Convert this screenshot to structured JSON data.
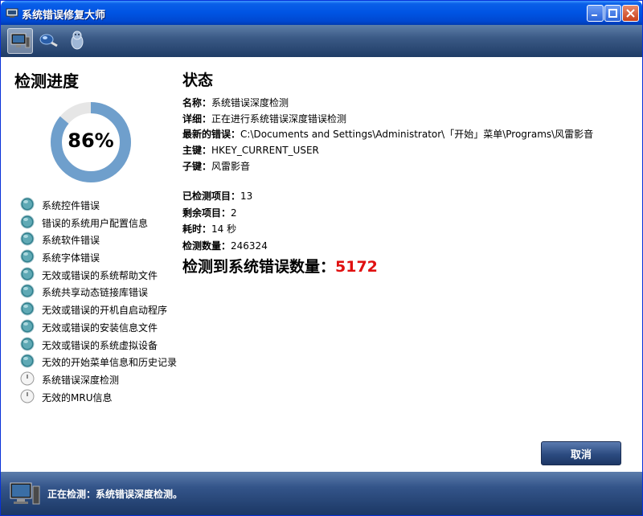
{
  "window": {
    "title": "系统错误修复大师"
  },
  "toolbar": {
    "icons": [
      "computer-icon",
      "search-icon",
      "tux-icon"
    ]
  },
  "progress": {
    "heading": "检测进度",
    "percent_text": "86%",
    "percent": 86
  },
  "checklist": [
    {
      "label": "系统控件错误",
      "state": "done"
    },
    {
      "label": "错误的系统用户配置信息",
      "state": "done"
    },
    {
      "label": "系统软件错误",
      "state": "done"
    },
    {
      "label": "系统字体错误",
      "state": "done"
    },
    {
      "label": "无效或错误的系统帮助文件",
      "state": "done"
    },
    {
      "label": "系统共享动态链接库错误",
      "state": "done"
    },
    {
      "label": "无效或错误的开机自启动程序",
      "state": "done"
    },
    {
      "label": "无效或错误的安装信息文件",
      "state": "done"
    },
    {
      "label": "无效或错误的系统虚拟设备",
      "state": "done"
    },
    {
      "label": "无效的开始菜单信息和历史记录(",
      "state": "done"
    },
    {
      "label": "系统错误深度检测",
      "state": "pending"
    },
    {
      "label": "无效的MRU信息",
      "state": "pending"
    }
  ],
  "status": {
    "heading": "状态",
    "name_label": "名称：",
    "name_value": "系统错误深度检测",
    "detail_label": "详细：",
    "detail_value": "正在进行系统错误深度错误检测",
    "latest_label": "最新的错误：",
    "latest_value": "C:\\Documents and Settings\\Administrator\\「开始」菜单\\Programs\\风雷影音",
    "key_label": "主键：",
    "key_value": "HKEY_CURRENT_USER",
    "subkey_label": "子键：",
    "subkey_value": "风雷影音",
    "checked_label": "已检测项目：",
    "checked_value": "13",
    "remaining_label": "剩余项目：",
    "remaining_value": "2",
    "elapsed_label": "耗时：",
    "elapsed_value": "14 秒",
    "count_label": "检测数量：",
    "count_value": "246324",
    "errors_label": "检测到系统错误数量：",
    "errors_value": "5172"
  },
  "buttons": {
    "cancel": "取消"
  },
  "statusbar": {
    "text": "正在检测：系统错误深度检测。"
  },
  "colors": {
    "accent_red": "#e01010",
    "ring": "#6f9fcc",
    "ring_track": "#e6e6e6"
  }
}
